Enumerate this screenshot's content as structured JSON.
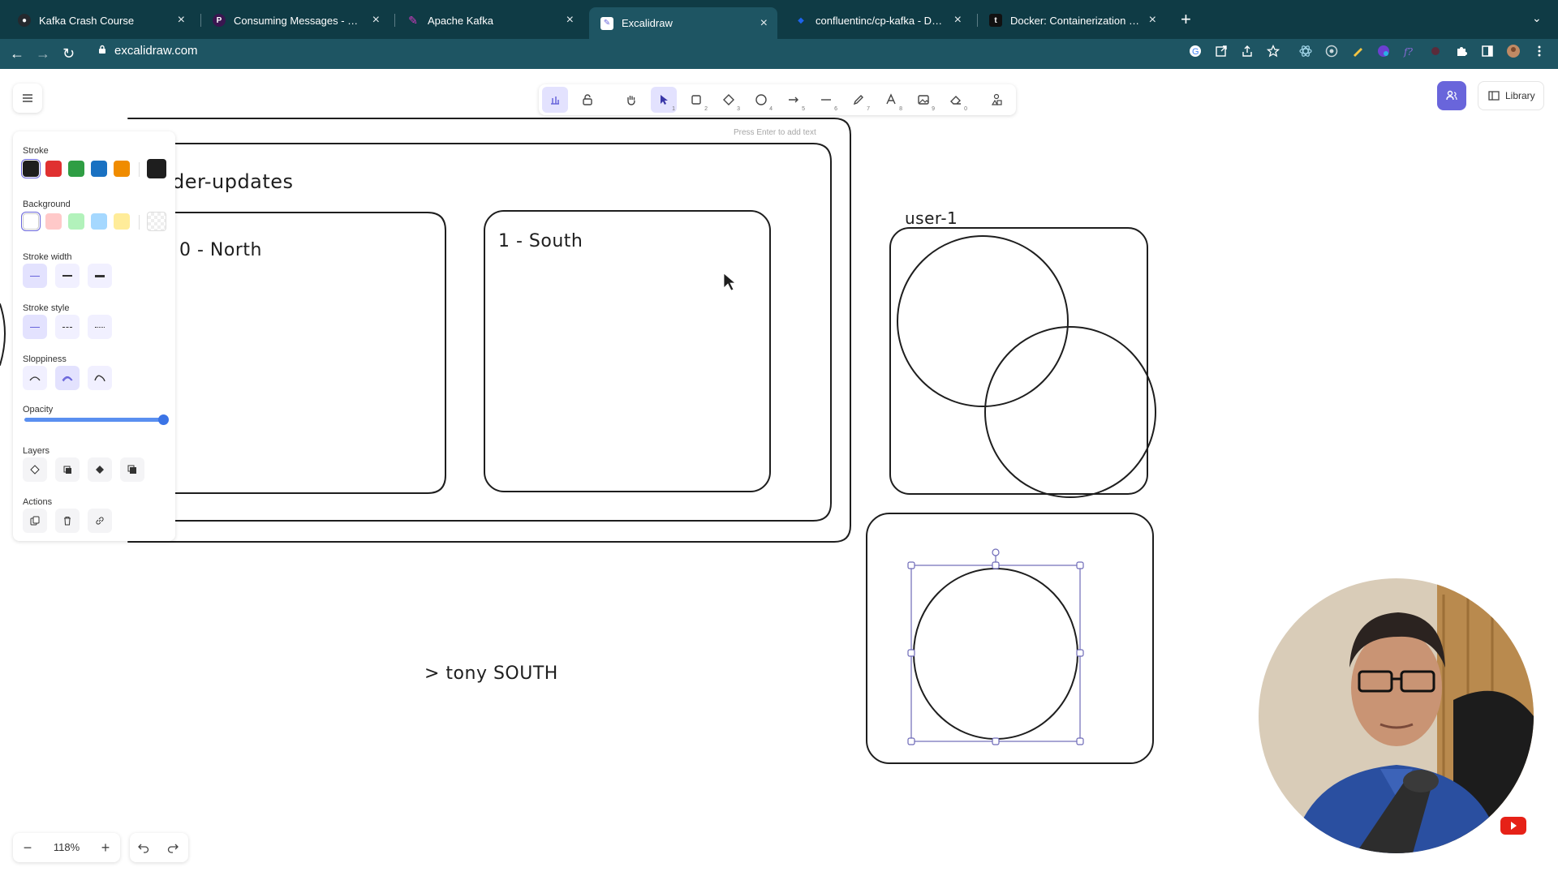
{
  "browser": {
    "tabs": [
      {
        "title": "Kafka Crash Course",
        "favicon": "github-icon"
      },
      {
        "title": "Consuming Messages - KafkaJS",
        "favicon": "kafkajs-icon"
      },
      {
        "title": "Apache Kafka",
        "favicon": "kafka-feather-icon"
      },
      {
        "title": "Excalidraw",
        "favicon": "excalidraw-icon"
      },
      {
        "title": "confluentinc/cp-kafka - Docker",
        "favicon": "docker-icon"
      },
      {
        "title": "Docker: Containerization for M",
        "favicon": "t-icon"
      }
    ],
    "url": "excalidraw.com"
  },
  "toolbar": {
    "tools": [
      {
        "name": "lock",
        "key": ""
      },
      {
        "name": "hand",
        "key": ""
      },
      {
        "name": "selection",
        "key": "1"
      },
      {
        "name": "rectangle",
        "key": "2"
      },
      {
        "name": "diamond",
        "key": "3"
      },
      {
        "name": "ellipse",
        "key": "4"
      },
      {
        "name": "arrow",
        "key": "5"
      },
      {
        "name": "line",
        "key": "6"
      },
      {
        "name": "draw",
        "key": "7"
      },
      {
        "name": "text",
        "key": "8"
      },
      {
        "name": "image",
        "key": "9"
      },
      {
        "name": "eraser",
        "key": "0"
      }
    ],
    "hint": "Press Enter to add text",
    "library_label": "Library"
  },
  "properties": {
    "stroke_label": "Stroke",
    "background_label": "Background",
    "stroke_width_label": "Stroke width",
    "stroke_style_label": "Stroke style",
    "sloppiness_label": "Sloppiness",
    "opacity_label": "Opacity",
    "layers_label": "Layers",
    "actions_label": "Actions",
    "stroke_colors": [
      "#1e1e1e",
      "#e03131",
      "#2f9e44",
      "#1971c2",
      "#f08c00"
    ],
    "stroke_current": "#1e1e1e",
    "background_colors": [
      "#ffffff",
      "#ffc9c9",
      "#b2f2bb",
      "#a5d8ff",
      "#ffec99"
    ],
    "opacity": 1.0
  },
  "zoom": {
    "value": "118%"
  },
  "canvas": {
    "topic_title": "der-updates",
    "partition_0": "0 - North",
    "partition_1": "1 - South",
    "consumer_label": "user-1",
    "message_text": "> tony SOUTH"
  },
  "colors": {
    "chrome_dark": "#0f3b45",
    "chrome_active": "#1e5563",
    "accent": "#6965db",
    "selected_tool": "#e3e2fe"
  }
}
